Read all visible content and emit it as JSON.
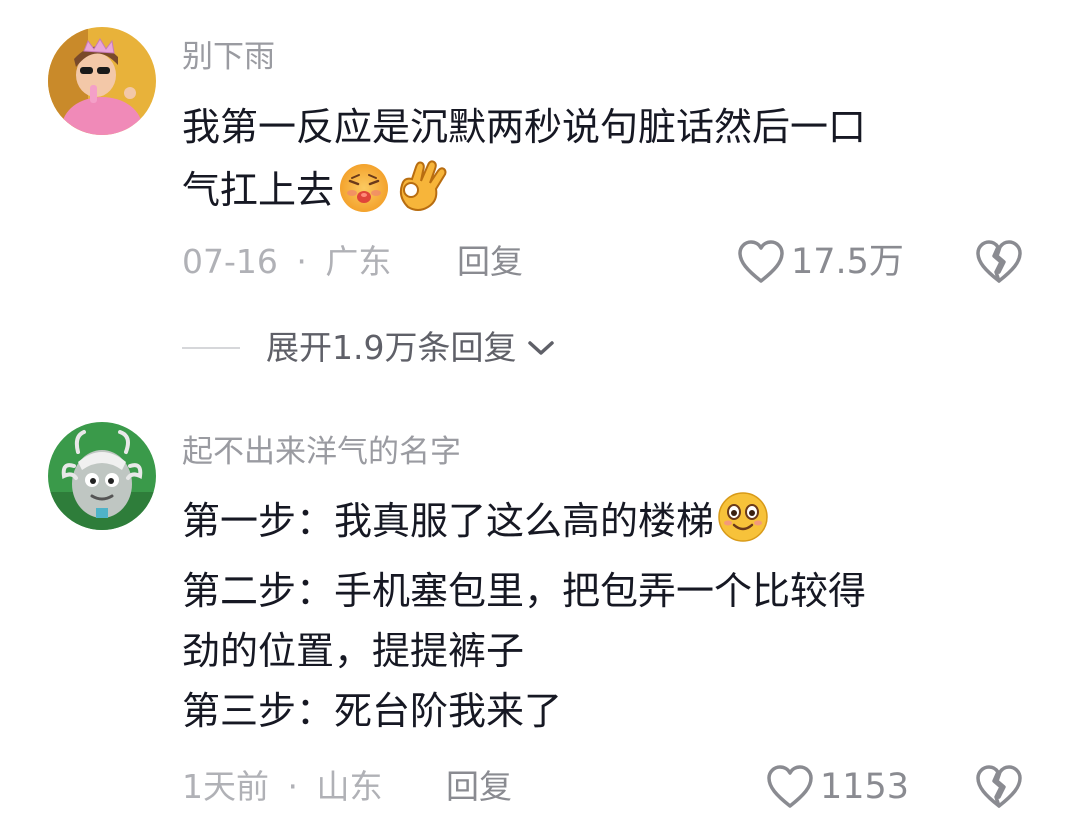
{
  "comments": [
    {
      "username": "别下雨",
      "lines": [
        "我第一反应是沉默两秒说句脏话然后一口",
        "气扛上去"
      ],
      "emojis": [
        "kiss-emoji",
        "ok-hand-emoji"
      ],
      "date": "07-16",
      "location": "广东",
      "separator": "·",
      "reply_label": "回复",
      "likes": "17.5万",
      "expand_label": "展开1.9万条回复",
      "avatar_icon": "girl-with-crown-avatar"
    },
    {
      "username": "起不出来洋气的名字",
      "lines": [
        "第一步：我真服了这么高的楼梯",
        "第二步：手机塞包里，把包弄一个比较得",
        "劲的位置，提提裤子",
        "第三步：死台阶我来了"
      ],
      "emojis": [
        "smile-emoji"
      ],
      "date": "1天前",
      "location": "山东",
      "separator": "·",
      "reply_label": "回复",
      "likes": "1153",
      "avatar_icon": "cartoon-dragon-avatar"
    }
  ],
  "colors": {
    "text_primary": "#161823",
    "text_username": "#9a9ba1",
    "text_meta": "#b0b1b6",
    "icon_gray": "#8a8b91"
  }
}
